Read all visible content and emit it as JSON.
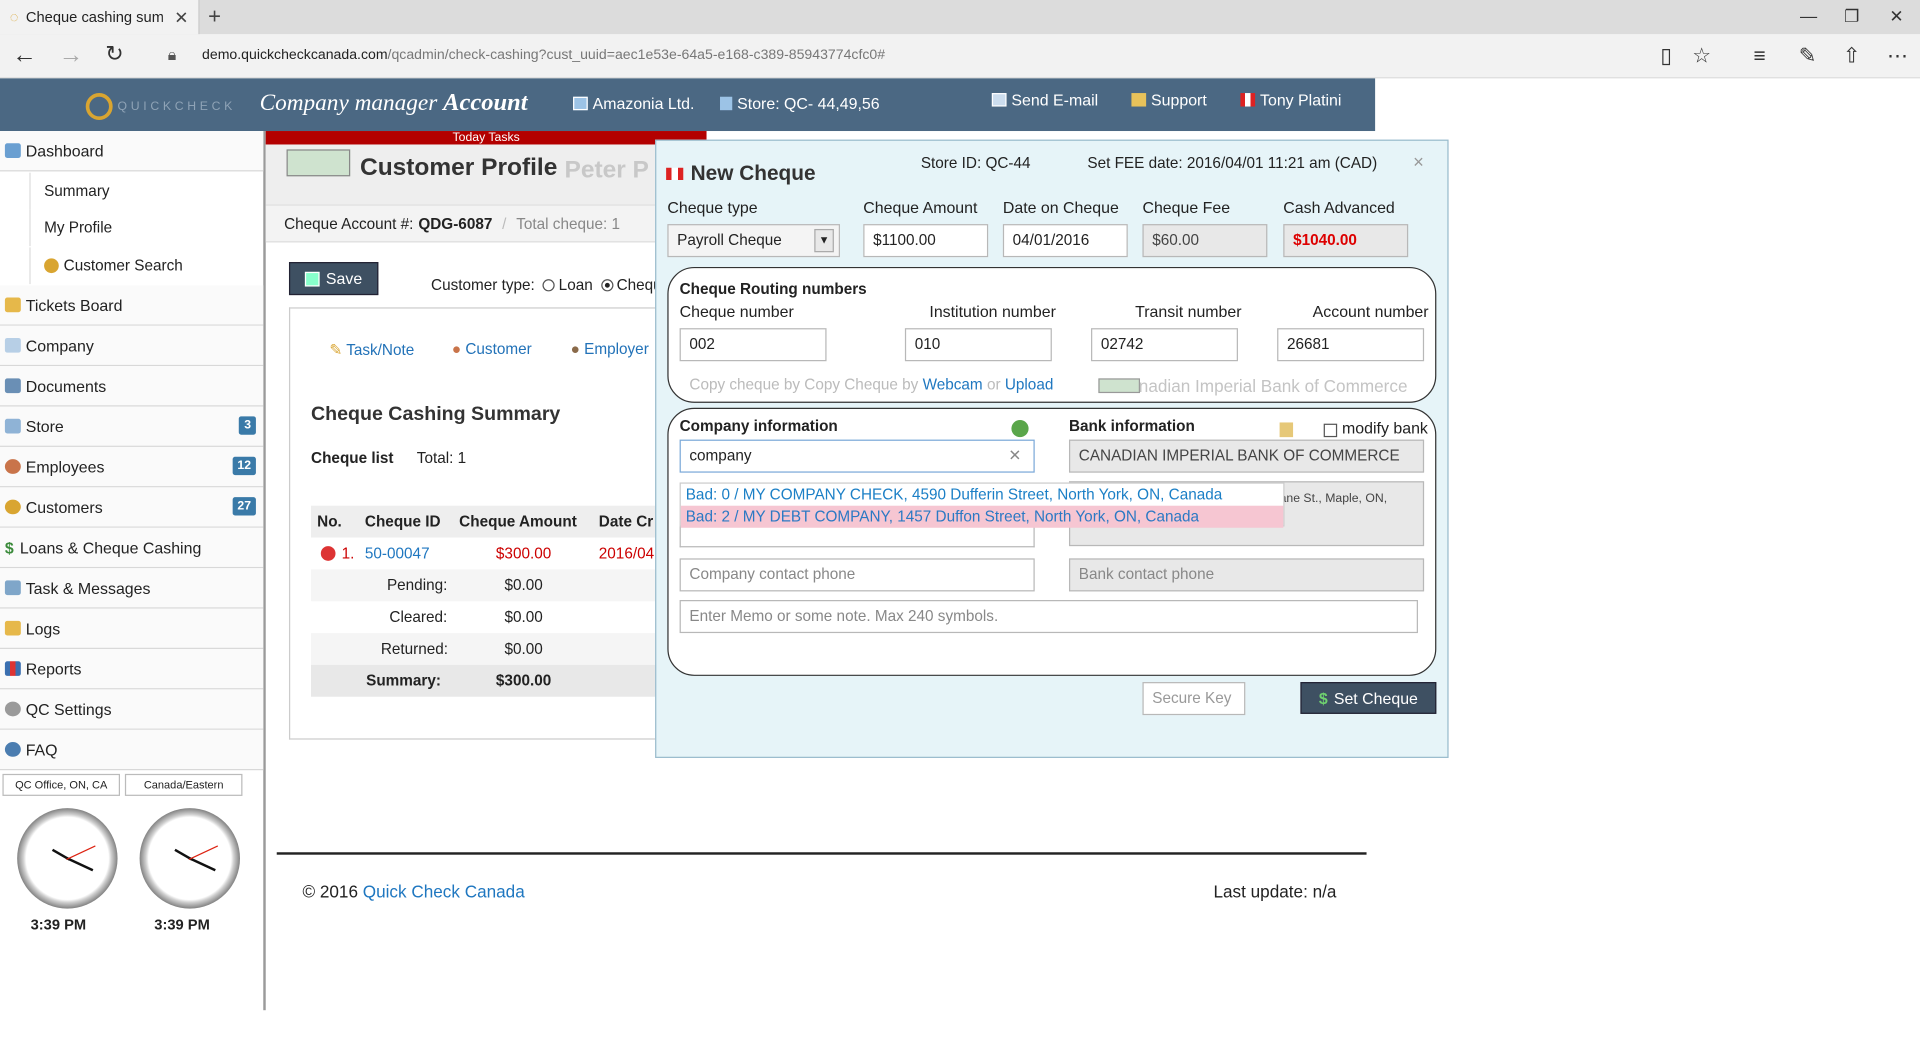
{
  "browser": {
    "tab_title": "Cheque cashing summa",
    "url_host": "demo.quickcheckcanada.com",
    "url_path": "/qcadmin/check-cashing?cust_uuid=aec1e53e-64a5-e168-c389-85943774cfc0#"
  },
  "header": {
    "logo_text": "QUICKCHECK",
    "title_prefix": "Company manager",
    "title_bold": "Account",
    "company": "Amazonia Ltd.",
    "store": "Store: QC- 44,49,56",
    "send_email": "Send E-mail",
    "support": "Support",
    "user": "Tony Platini"
  },
  "sidebar": {
    "items": [
      {
        "label": "Dashboard"
      },
      {
        "label": "Tickets Board"
      },
      {
        "label": "Company"
      },
      {
        "label": "Documents"
      },
      {
        "label": "Store",
        "badge": "3"
      },
      {
        "label": "Employees",
        "badge": "12"
      },
      {
        "label": "Customers",
        "badge": "27"
      },
      {
        "label": "Loans & Cheque Cashing"
      },
      {
        "label": "Task & Messages"
      },
      {
        "label": "Logs"
      },
      {
        "label": "Reports"
      },
      {
        "label": "QC Settings"
      },
      {
        "label": "FAQ"
      }
    ],
    "subitems": [
      "Summary",
      "My Profile",
      "Customer Search"
    ],
    "clocks": [
      {
        "zone": "QC Office, ON, CA",
        "time": "3:39 PM"
      },
      {
        "zone": "Canada/Eastern",
        "time": "3:39 PM"
      }
    ]
  },
  "main": {
    "today_tasks": "Today Tasks",
    "profile_title": "Customer Profile",
    "profile_name": "Peter P",
    "account_label": "Cheque Account #:",
    "account_no": "QDG-6087",
    "total_cheque": "Total cheque: 1",
    "save": "Save",
    "customer_type_label": "Customer type:",
    "type_loan": "Loan",
    "type_cheque": "Chequ",
    "tabs": [
      "Task/Note",
      "Customer",
      "Employer"
    ],
    "summary_title": "Cheque Cashing Summary",
    "cheque_list": "Cheque list",
    "total": "Total: 1",
    "table": {
      "headers": [
        "No.",
        "Cheque ID",
        "Cheque Amount",
        "Date Cr"
      ],
      "row": {
        "no": "1.",
        "id": "50-00047",
        "amount": "$300.00",
        "date": "2016/04"
      },
      "pending_label": "Pending:",
      "pending": "$0.00",
      "cleared_label": "Cleared:",
      "cleared": "$0.00",
      "returned_label": "Returned:",
      "returned": "$0.00",
      "summary_label": "Summary:",
      "summary": "$300.00"
    }
  },
  "footer": {
    "copyright": "© 2016",
    "brand": "Quick Check Canada",
    "last_update": "Last update: n/a"
  },
  "modal": {
    "title": "New Cheque",
    "store_id": "Store ID: QC-44",
    "fee_date": "Set FEE date: 2016/04/01 11:21 am (CAD)",
    "close": "×",
    "cheque_type_label": "Cheque type",
    "cheque_type": "Payroll Cheque",
    "amount_label": "Cheque Amount",
    "amount": "$1100.00",
    "date_label": "Date on Cheque",
    "date": "04/01/2016",
    "fee_label": "Cheque Fee",
    "fee": "$60.00",
    "cash_label": "Cash Advanced",
    "cash": "$1040.00",
    "routing_title": "Cheque Routing numbers",
    "cheque_no_label": "Cheque number",
    "cheque_no": "002",
    "institution_label": "Institution number",
    "institution": "010",
    "transit_label": "Transit number",
    "transit": "02742",
    "account_label": "Account number",
    "account": "26681",
    "copy_text": "Copy cheque by Copy Cheque by",
    "webcam": "Webcam",
    "or": "or",
    "upload": "Upload",
    "bank_name_faded": "nadian Imperial Bank of Commerce",
    "company_info": "Company information",
    "company_search": "company",
    "bank_info": "Bank information",
    "modify_bank": "modify bank",
    "bank_name": "CANADIAN IMPERIAL BANK OF COMMERCE",
    "bank_address": "ane St., Maple, ON,",
    "dropdown": [
      "Bad: 0 / MY COMPANY CHECK, 4590 Dufferin Street, North York, ON, Canada",
      "Bad: 2 / MY DEBT COMPANY, 1457 Duffon Street, North York, ON, Canada"
    ],
    "company_phone_ph": "Company contact phone",
    "bank_phone_ph": "Bank contact phone",
    "memo_ph": "Enter Memo or some note. Max 240 symbols.",
    "secure_key_ph": "Secure Key",
    "set_cheque": "Set Cheque"
  },
  "colors": {
    "header_bg": "#4b6883",
    "accent_red": "#cc0000",
    "link_blue": "#1f77c0",
    "button_dark": "#3e5062"
  }
}
